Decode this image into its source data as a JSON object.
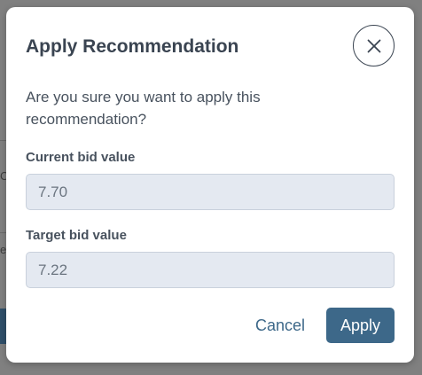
{
  "dialog": {
    "title": "Apply Recommendation",
    "message": "Are you sure you want to apply this recommendation?",
    "close_icon": "close-icon",
    "fields": [
      {
        "label": "Current bid value",
        "value": "7.70"
      },
      {
        "label": "Target bid value",
        "value": "7.22"
      }
    ],
    "cancel_label": "Cancel",
    "apply_label": "Apply"
  },
  "colors": {
    "overlay": "#808080",
    "dialog_background": "#ffffff",
    "title_text": "#3a4451",
    "input_background": "#e4e9f1",
    "accent": "#3d6889"
  }
}
